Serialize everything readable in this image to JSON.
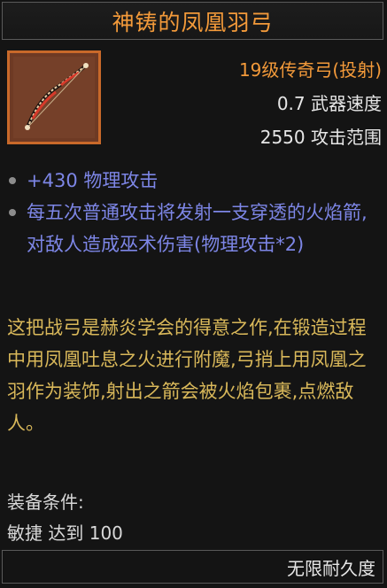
{
  "item": {
    "name": "神铸的凤凰羽弓",
    "icon": "phoenix-feather-bow-icon",
    "rarity_line": "19级传奇弓(投射)",
    "attack_speed": "0.7 武器速度",
    "attack_range": "2550 攻击范围"
  },
  "affixes": [
    "+430 物理攻击",
    "每五次普通攻击将发射一支穿透的火焰箭,对敌人造成巫术伤害(物理攻击*2)"
  ],
  "flavor_text": "这把战弓是赫炎学会的得意之作,在锻造过程中用凤凰吐息之火进行附魔,弓捎上用凤凰之羽作为装饰,射出之箭会被火焰包裹,点燃敌人。",
  "requirements": {
    "title": "装备条件:",
    "line": "敏捷 达到 100"
  },
  "durability": "无限耐久度",
  "colors": {
    "title": "#f39a3a",
    "rarity": "#f39a3a",
    "affix": "#7d86e6",
    "flavor": "#d9b85a",
    "icon_frame": "#c8692a"
  }
}
